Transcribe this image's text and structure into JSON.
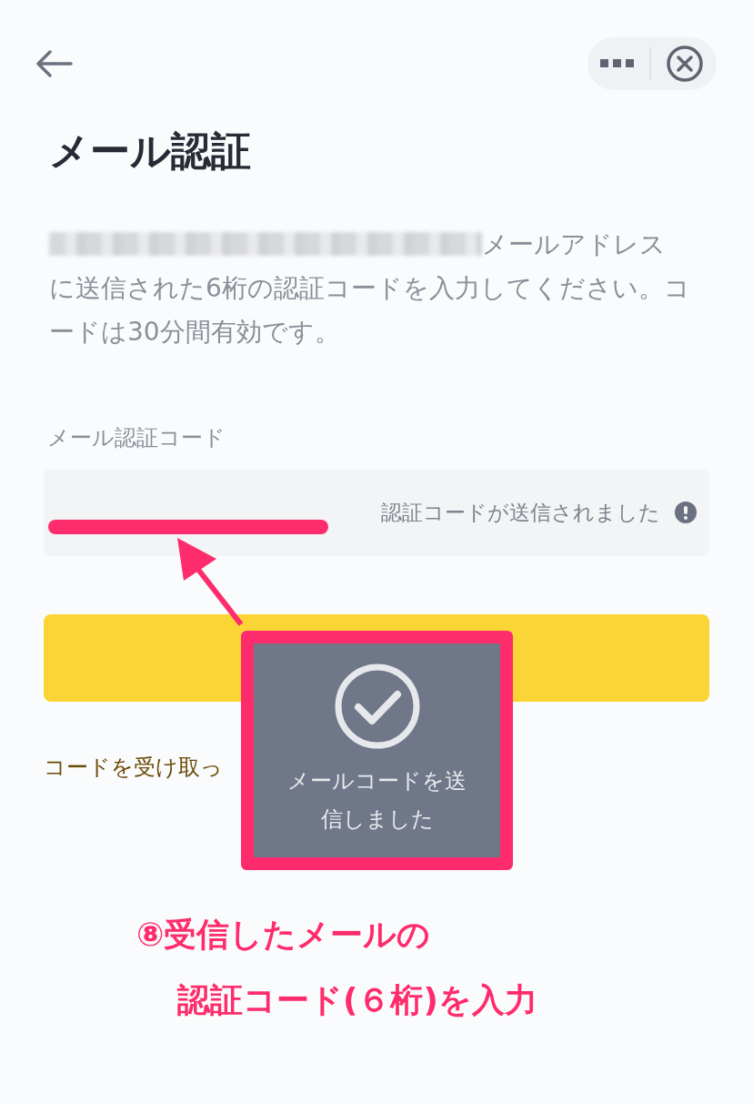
{
  "title": "メール認証",
  "description": {
    "email_masked": true,
    "text": "メールアドレスに送信された6桁の認証コードを入力してください。コードは30分間有効です。"
  },
  "code_field": {
    "label": "メール認証コード",
    "hint": "認証コードが送信されました"
  },
  "resend_link": "コードを受け取っ",
  "toast": {
    "message": "メールコードを送信しました"
  },
  "annotation": {
    "lines": [
      "⑧受信したメールの",
      "認証コード(６桁)を入力"
    ]
  }
}
